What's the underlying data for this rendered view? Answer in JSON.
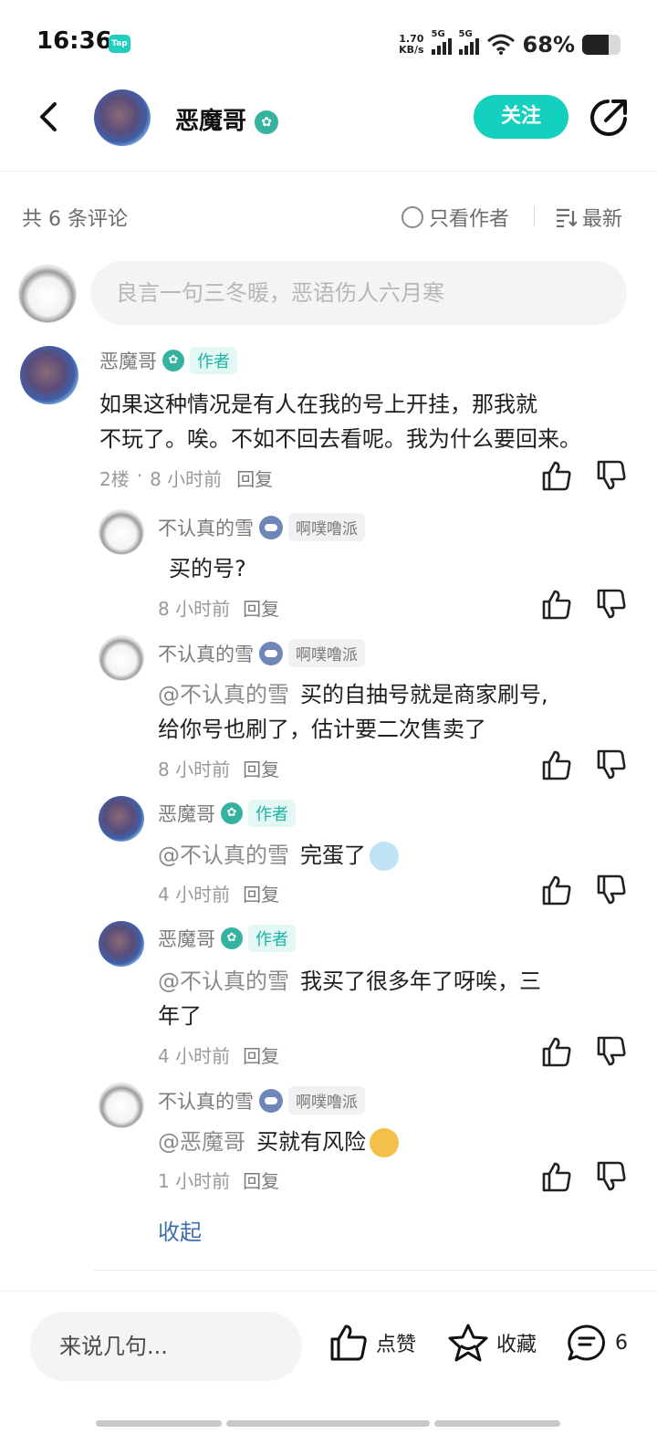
{
  "status_bar": {
    "time": "16:36",
    "app_badge": "Tap",
    "net_speed_value": "1.70",
    "net_speed_unit": "KB/s",
    "signal1_label": "5G",
    "signal2_label": "5G",
    "battery_percent": "68%",
    "battery_level": 0.68
  },
  "header": {
    "author_name": "恶魔哥",
    "follow_label": "关注"
  },
  "meta": {
    "count_text": "共 6 条评论",
    "only_author_label": "只看作者",
    "sort_label": "最新"
  },
  "input": {
    "placeholder": "良言一句三冬暖，恶语伤人六月寒"
  },
  "comments": {
    "main": {
      "name": "恶魔哥",
      "tag": "作者",
      "text_line1": "如果这种情况是有人在我的号上开挂，那我就",
      "text_line2": "不玩了。唉。不如不回去看呢。我为什么要回来。",
      "floor": "2楼",
      "dot": "·",
      "time": "8 小时前",
      "reply": "回复"
    },
    "replies": [
      {
        "name": "不认真的雪",
        "tag": "啊噗噜派",
        "mention": "",
        "text": "买的号?",
        "time": "8 小时前",
        "reply": "回复"
      },
      {
        "name": "不认真的雪",
        "tag": "啊噗噜派",
        "mention": "@不认真的雪",
        "text": "买的自抽号就是商家刷号,",
        "text2": "给你号也刷了，估计要二次售卖了",
        "time": "8 小时前",
        "reply": "回复"
      },
      {
        "name": "恶魔哥",
        "tag": "作者",
        "mention": "@不认真的雪",
        "text": "完蛋了",
        "time": "4 小时前",
        "reply": "回复"
      },
      {
        "name": "恶魔哥",
        "tag": "作者",
        "mention": "@不认真的雪",
        "text": "我买了很多年了呀唉，三",
        "text2": "年了",
        "time": "4 小时前",
        "reply": "回复"
      },
      {
        "name": "不认真的雪",
        "tag": "啊噗噜派",
        "mention": "@恶魔哥",
        "text": "买就有风险",
        "time": "1 小时前",
        "reply": "回复"
      }
    ],
    "collapse_label": "收起"
  },
  "bottom_bar": {
    "say_placeholder": "来说几句...",
    "like_label": "点赞",
    "fav_label": "收藏",
    "comment_count": "6"
  },
  "icons": {
    "back": "chevron-left-icon",
    "share": "share-icon",
    "like": "thumb-up-icon",
    "dislike": "thumb-down-icon",
    "sort": "sort-lines-icon",
    "favorite": "star-icon",
    "comment": "comment-bubble-icon"
  },
  "colors": {
    "accent": "#14d0be",
    "author_tag": "#1ab3a1",
    "link": "#3d6fae"
  }
}
